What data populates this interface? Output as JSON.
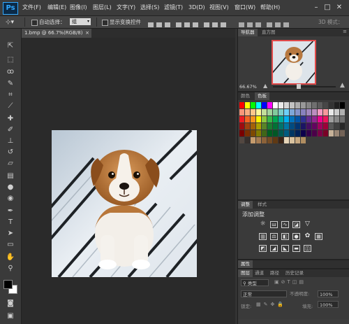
{
  "app": {
    "logo": "Ps"
  },
  "menu": [
    "文件(F)",
    "编辑(E)",
    "图像(I)",
    "图层(L)",
    "文字(Y)",
    "选择(S)",
    "滤镜(T)",
    "3D(D)",
    "视图(V)",
    "窗口(W)",
    "帮助(H)"
  ],
  "window_buttons": {
    "minimize": "–",
    "maximize": "□",
    "close": "✕"
  },
  "options_bar": {
    "auto_select_label": "自动选择：",
    "auto_select_value": "组",
    "show_transform_label": "显示变换控件",
    "mode_label": "3D 模式："
  },
  "document": {
    "tab_title": "1.bmp @ 66.7%(RGB/8)",
    "tab_close": "×"
  },
  "navigator": {
    "tabs": [
      "导航器",
      "直方图"
    ],
    "zoom": "66.67%"
  },
  "swatches": {
    "tabs": [
      "颜色",
      "色板"
    ],
    "colors": [
      [
        "#ff0000",
        "#ffff00",
        "#00ff00",
        "#00ffff",
        "#0000ff",
        "#ff00ff",
        "#ffffff",
        "#ebebeb",
        "#d6d6d6",
        "#c2c2c2",
        "#adadad",
        "#999999",
        "#858585",
        "#707070",
        "#5c5c5c",
        "#474747",
        "#333333",
        "#1f1f1f",
        "#000000"
      ],
      [
        "#f7977a",
        "#f9ad81",
        "#fdc68a",
        "#fff79a",
        "#c4df9b",
        "#a2d39c",
        "#82ca9d",
        "#7bcdc8",
        "#6ecff6",
        "#7ea7d8",
        "#8493ca",
        "#8882be",
        "#a187be",
        "#bc8dbf",
        "#f49ac2",
        "#f6989d",
        "#e8e8e8",
        "#cccccc",
        "#b0b0b0"
      ],
      [
        "#ed1c24",
        "#f26522",
        "#f7941d",
        "#fff200",
        "#8dc73f",
        "#39b54a",
        "#00a651",
        "#00a99d",
        "#00aeef",
        "#0072bc",
        "#0054a6",
        "#2e3192",
        "#662d91",
        "#92278f",
        "#ec008c",
        "#ed145b",
        "#a0a0a0",
        "#888888",
        "#707070"
      ],
      [
        "#9e0b0f",
        "#a0410d",
        "#a36209",
        "#aba000",
        "#598527",
        "#1a7b30",
        "#007236",
        "#00746b",
        "#0076a3",
        "#004b80",
        "#003471",
        "#1b1464",
        "#440e62",
        "#630460",
        "#9e005d",
        "#9e0039",
        "#585858",
        "#404040",
        "#282828"
      ],
      [
        "#790000",
        "#7b2e00",
        "#7d4900",
        "#827b00",
        "#406618",
        "#005e20",
        "#005826",
        "#005952",
        "#005b7f",
        "#003663",
        "#002157",
        "#0d004c",
        "#32004b",
        "#4b0049",
        "#7b0046",
        "#7a0026",
        "#c7b299",
        "#998675",
        "#736357"
      ],
      [
        "#534741",
        "#37302d",
        "#c69c6d",
        "#a67c52",
        "#8c6239",
        "#754c24",
        "#603913",
        "#3c2415",
        "#e6d5b8",
        "#d9c29f",
        "#c7a880",
        "#b08e61"
      ]
    ]
  },
  "adjustments": {
    "tabs": [
      "调整",
      "样式"
    ],
    "title": "添加调整"
  },
  "properties": {
    "tab": "属性"
  },
  "layers": {
    "tabs": [
      "图层",
      "通道",
      "路径",
      "历史记录"
    ],
    "kind_label": "类型",
    "blend_mode": "正常",
    "opacity_label": "不透明度:",
    "opacity_value": "100%",
    "lock_label": "锁定:",
    "fill_label": "填充:",
    "fill_value": "100%"
  },
  "icons": {
    "move": "move-tool",
    "marquee": "marquee-tool",
    "lasso": "lasso-tool",
    "quick_select": "quick-select-tool",
    "crop": "crop-tool",
    "eyedropper": "eyedropper-tool",
    "heal": "healing-brush-tool",
    "brush": "brush-tool",
    "stamp": "clone-stamp-tool",
    "history": "history-brush-tool",
    "eraser": "eraser-tool",
    "gradient": "gradient-tool",
    "blur": "blur-tool",
    "dodge": "dodge-tool",
    "pen": "pen-tool",
    "type": "type-tool",
    "path": "path-select-tool",
    "shape": "rectangle-tool",
    "hand": "hand-tool",
    "zoom": "zoom-tool"
  },
  "colors": {
    "foreground": "#000000",
    "background": "#ffffff",
    "nav_frame": "#e24a4a",
    "accent": "#31a8ff"
  }
}
